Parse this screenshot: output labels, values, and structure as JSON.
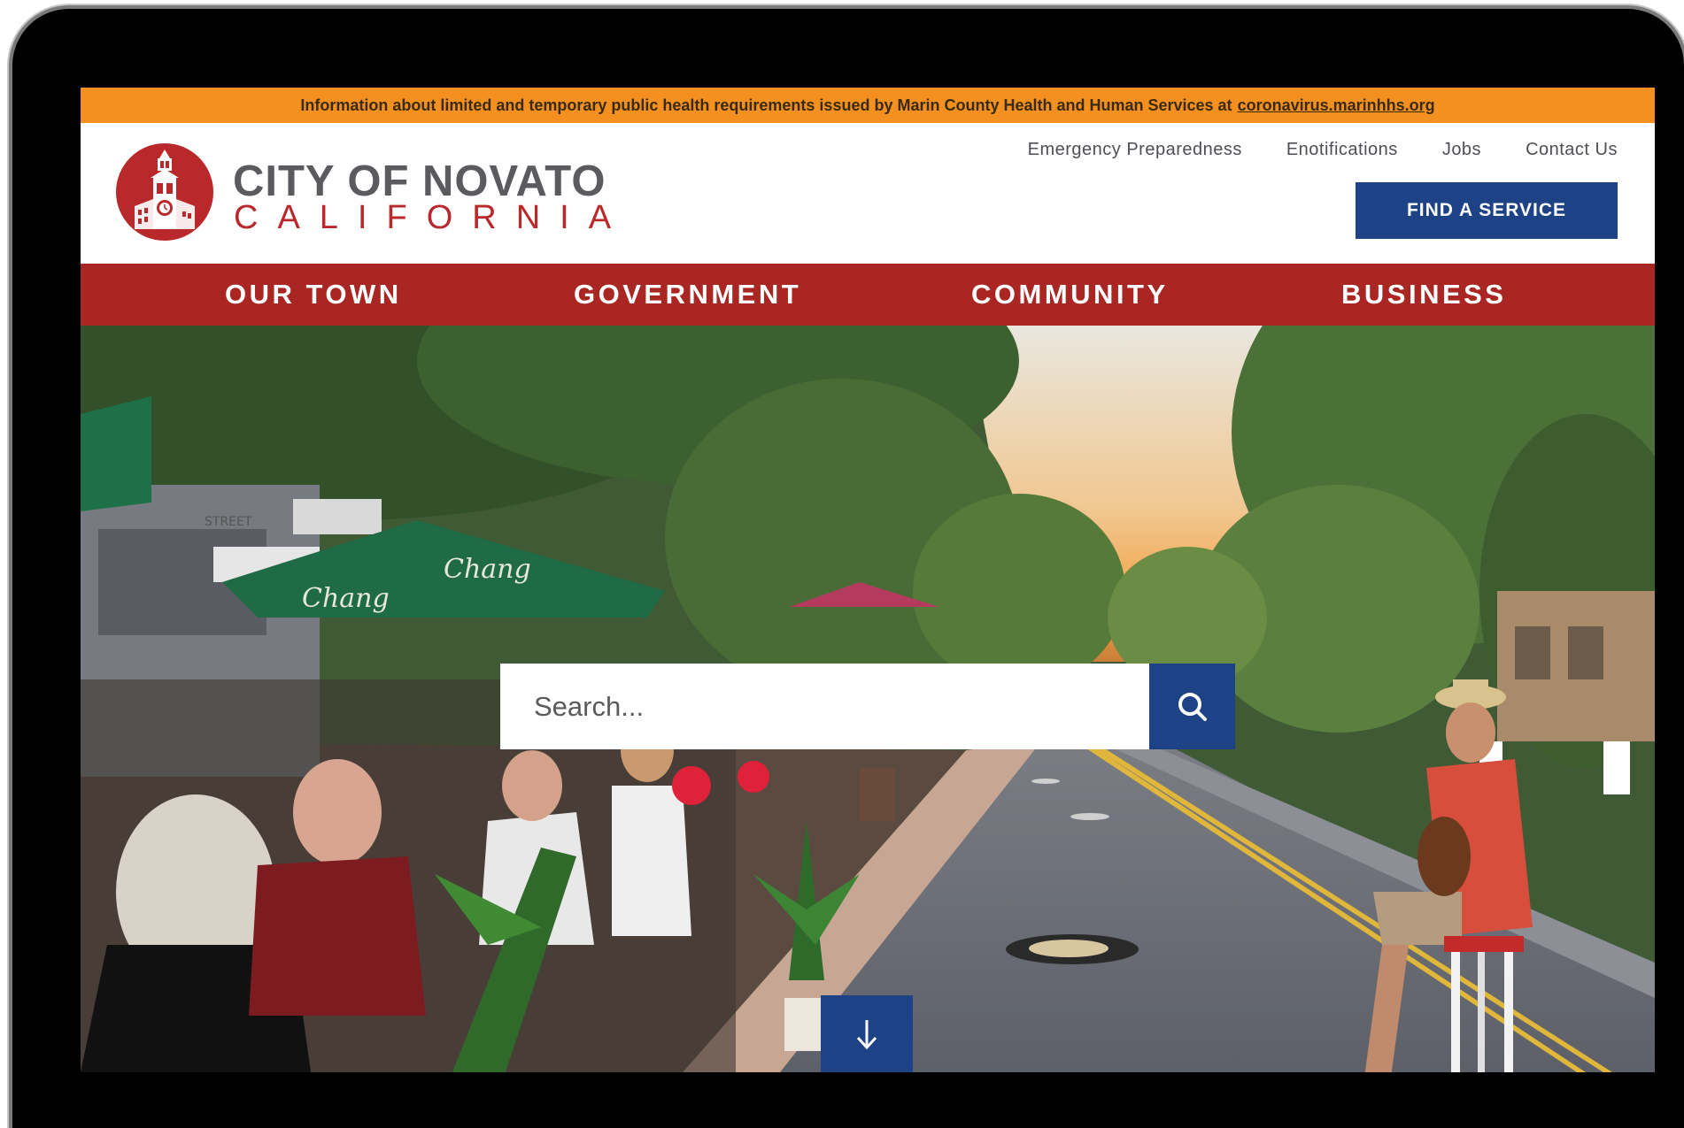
{
  "alert": {
    "text": "Information about limited and temporary public health requirements issued by Marin County Health and Human Services at",
    "link": "coronavirus.marinhhs.org"
  },
  "brand": {
    "name": "CITY OF NOVATO",
    "state": "CALIFORNIA",
    "logo_icon": "clock-tower-seal-icon"
  },
  "utility_nav": [
    "Emergency Preparedness",
    "Enotifications",
    "Jobs",
    "Contact Us"
  ],
  "find_service_label": "FIND A SERVICE",
  "main_nav": [
    "OUR TOWN",
    "GOVERNMENT",
    "COMMUNITY",
    "BUSINESS"
  ],
  "search": {
    "placeholder": "Search...",
    "icon": "search-icon"
  },
  "scroll_icon": "arrow-down-icon",
  "hero_signage": [
    "Chang",
    "Chang",
    "STREET"
  ],
  "colors": {
    "alert_bg": "#f3901f",
    "brand_red": "#aa2623",
    "brand_blue": "#1d4286",
    "brand_grey": "#5a5a5f"
  }
}
